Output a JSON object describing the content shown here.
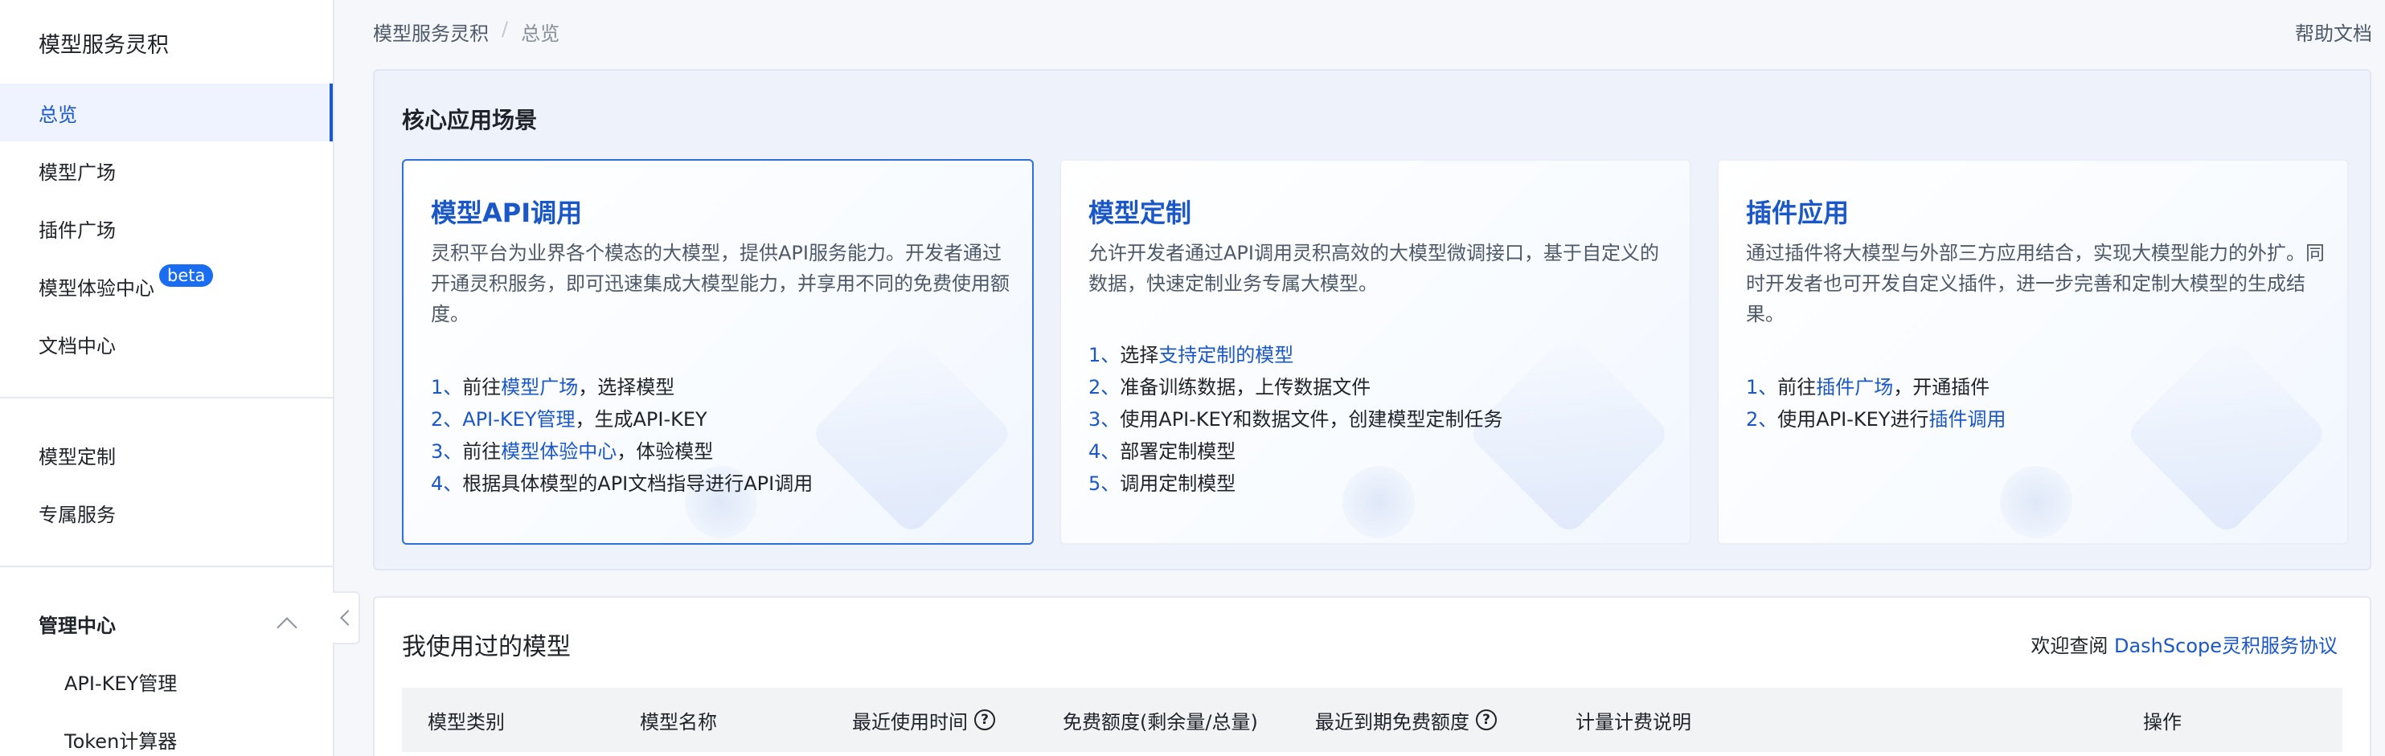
{
  "sidebar": {
    "title": "模型服务灵积",
    "items": [
      {
        "label": "总览",
        "active": true
      },
      {
        "label": "模型广场"
      },
      {
        "label": "插件广场"
      },
      {
        "label": "模型体验中心",
        "badge": "beta"
      },
      {
        "label": "文档中心"
      },
      {
        "label": "模型定制"
      },
      {
        "label": "专属服务"
      }
    ],
    "group": {
      "label": "管理中心",
      "items": [
        {
          "label": "API-KEY管理"
        },
        {
          "label": "Token计算器"
        }
      ]
    }
  },
  "topbar": {
    "breadcrumb": [
      "模型服务灵积",
      "总览"
    ],
    "separator": "/",
    "help": "帮助文档"
  },
  "core": {
    "title": "核心应用场景",
    "cards": [
      {
        "title": "模型API调用",
        "desc": "灵积平台为业界各个模态的大模型，提供API服务能力。开发者通过开通灵积服务，即可迅速集成大模型能力，并享用不同的免费使用额度。",
        "steps": [
          {
            "num": "1",
            "pre": "前往",
            "link": "模型广场",
            "post": "，选择模型"
          },
          {
            "num": "2",
            "pre": "",
            "link": "API-KEY管理",
            "post": "，生成API-KEY"
          },
          {
            "num": "3",
            "pre": "前往",
            "link": "模型体验中心",
            "post": "，体验模型"
          },
          {
            "num": "4",
            "pre": "根据具体模型的API文档指导进行API调用",
            "link": "",
            "post": ""
          }
        ]
      },
      {
        "title": "模型定制",
        "desc": "允许开发者通过API调用灵积高效的大模型微调接口，基于自定义的数据，快速定制业务专属大模型。",
        "steps": [
          {
            "num": "1",
            "pre": "选择",
            "link": "支持定制的模型",
            "post": ""
          },
          {
            "num": "2",
            "pre": "准备训练数据，上传数据文件",
            "link": "",
            "post": ""
          },
          {
            "num": "3",
            "pre": "使用API-KEY和数据文件，创建模型定制任务",
            "link": "",
            "post": ""
          },
          {
            "num": "4",
            "pre": "部署定制模型",
            "link": "",
            "post": ""
          },
          {
            "num": "5",
            "pre": "调用定制模型",
            "link": "",
            "post": ""
          }
        ]
      },
      {
        "title": "插件应用",
        "desc": "通过插件将大模型与外部三方应用结合，实现大模型能力的外扩。同时开发者也可开发自定义插件，进一步完善和定制大模型的生成结果。",
        "steps": [
          {
            "num": "1",
            "pre": "前往",
            "link": "插件广场",
            "post": "，开通插件"
          },
          {
            "num": "2",
            "pre": "使用API-KEY进行",
            "link": "插件调用",
            "post": ""
          }
        ]
      }
    ]
  },
  "models": {
    "title": "我使用过的模型",
    "agreement_prefix": "欢迎查阅",
    "agreement_link": "DashScope灵积服务协议",
    "columns": [
      "模型类别",
      "模型名称",
      "最近使用时间",
      "免费额度(剩余量/总量)",
      "最近到期免费额度",
      "计量计费说明",
      "操作"
    ]
  },
  "colors": {
    "accent": "#1a57c9",
    "badge": "#1a6cf0",
    "panel_bg": "#eef3fb"
  }
}
